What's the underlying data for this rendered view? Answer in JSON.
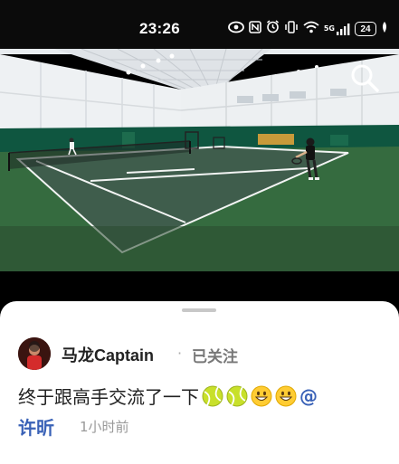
{
  "status": {
    "time": "23:26",
    "net": "5G",
    "battery": "24"
  },
  "icons": {
    "search": "search-icon",
    "eye": "eye-icon",
    "nfc": "nfc-icon",
    "alarm": "alarm-icon",
    "vibrate": "vibrate-icon",
    "wifi": "wifi-icon",
    "signal": "signal-icon",
    "leaf": "eco-leaf-icon"
  },
  "post": {
    "username": "马龙Captain",
    "follow_status": "已关注",
    "caption": "终于跟高手交流了一下",
    "at_sign": "@",
    "mention": "许昕",
    "time_ago": "1小时前"
  },
  "colors": {
    "court": "#3f5d4c",
    "surround": "#2f6a3c",
    "mention": "#3a62b7"
  }
}
